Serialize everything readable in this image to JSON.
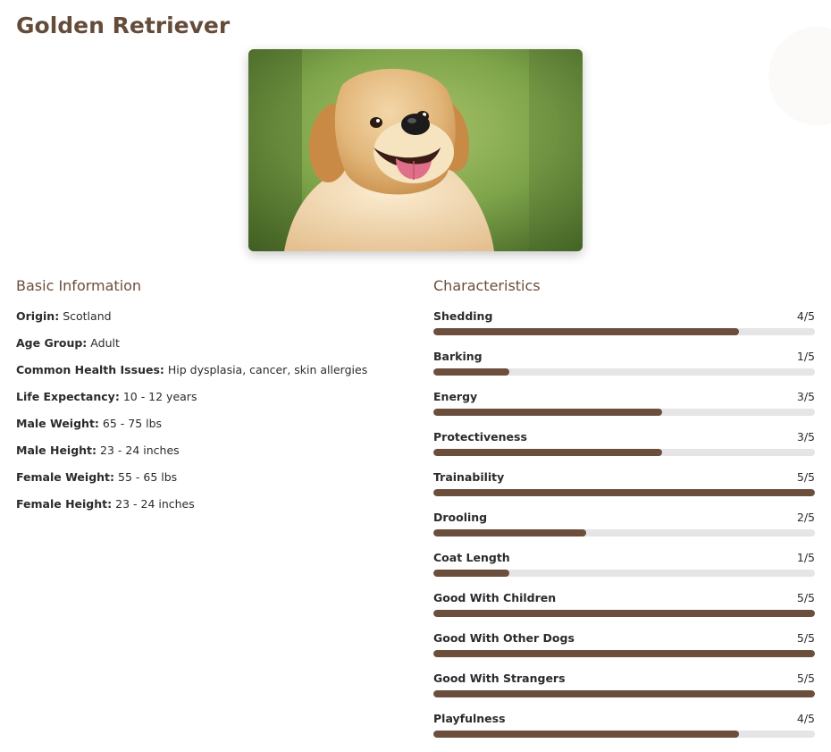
{
  "page": {
    "title": "Golden Retriever"
  },
  "photo": {
    "subject": "golden-retriever-photo"
  },
  "basic_info": {
    "heading": "Basic Information",
    "rows": [
      {
        "label": "Origin:",
        "value": "Scotland"
      },
      {
        "label": "Age Group:",
        "value": "Adult"
      },
      {
        "label": "Common Health Issues:",
        "value": "Hip dysplasia, cancer, skin allergies"
      },
      {
        "label": "Life Expectancy:",
        "value": "10 - 12 years"
      },
      {
        "label": "Male Weight:",
        "value": "65 - 75 lbs"
      },
      {
        "label": "Male Height:",
        "value": "23 - 24 inches"
      },
      {
        "label": "Female Weight:",
        "value": "55 - 65 lbs"
      },
      {
        "label": "Female Height:",
        "value": "23 - 24 inches"
      }
    ]
  },
  "characteristics": {
    "heading": "Characteristics",
    "max": 5,
    "items": [
      {
        "name": "Shedding",
        "score": 4,
        "score_text": "4/5"
      },
      {
        "name": "Barking",
        "score": 1,
        "score_text": "1/5"
      },
      {
        "name": "Energy",
        "score": 3,
        "score_text": "3/5"
      },
      {
        "name": "Protectiveness",
        "score": 3,
        "score_text": "3/5"
      },
      {
        "name": "Trainability",
        "score": 5,
        "score_text": "5/5"
      },
      {
        "name": "Drooling",
        "score": 2,
        "score_text": "2/5"
      },
      {
        "name": "Coat Length",
        "score": 1,
        "score_text": "1/5"
      },
      {
        "name": "Good With Children",
        "score": 5,
        "score_text": "5/5"
      },
      {
        "name": "Good With Other Dogs",
        "score": 5,
        "score_text": "5/5"
      },
      {
        "name": "Good With Strangers",
        "score": 5,
        "score_text": "5/5"
      },
      {
        "name": "Playfulness",
        "score": 4,
        "score_text": "4/5"
      }
    ]
  },
  "colors": {
    "accent": "#6b4e3b",
    "title": "#654c3a",
    "track": "#e6e4e6"
  }
}
